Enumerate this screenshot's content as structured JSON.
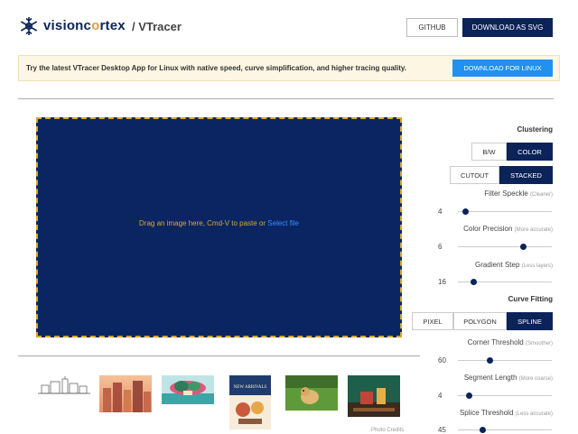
{
  "header": {
    "brand_a": "visionc",
    "brand_o": "o",
    "brand_b": "rtex",
    "title": "/ VTracer",
    "github_label": "GITHUB",
    "download_svg_label": "DOWNLOAD AS SVG"
  },
  "banner": {
    "text": "Try the latest VTracer Desktop App for Linux with native speed, curve simplification, and higher tracing quality.",
    "button_label": "DOWNLOAD FOR LINUX"
  },
  "canvas": {
    "drop_text": "Drag an image here, Cmd-V to paste or ",
    "select_link": "Select file"
  },
  "gallery": {
    "credits": "Photo Credits"
  },
  "clustering": {
    "title": "Clustering",
    "mode_options": [
      "B/W",
      "COLOR"
    ],
    "mode_selected": "COLOR",
    "layer_options": [
      "CUTOUT",
      "STACKED"
    ],
    "layer_selected": "STACKED",
    "params": [
      {
        "label": "Filter Speckle",
        "hint": "(Cleaner)",
        "value": "4",
        "fraction": 0.05
      },
      {
        "label": "Color Precision",
        "hint": "(More accurate)",
        "value": "6",
        "fraction": 0.71
      },
      {
        "label": "Gradient Step",
        "hint": "(Less layers)",
        "value": "16",
        "fraction": 0.14
      }
    ]
  },
  "curve_fitting": {
    "title": "Curve Fitting",
    "mode_options": [
      "PIXEL",
      "POLYGON",
      "SPLINE"
    ],
    "mode_selected": "SPLINE",
    "params": [
      {
        "label": "Corner Threshold",
        "hint": "(Smoother)",
        "value": "60",
        "fraction": 0.33
      },
      {
        "label": "Segment Length",
        "hint": "(More coarse)",
        "value": "4",
        "fraction": 0.09
      },
      {
        "label": "Splice Threshold",
        "hint": "(Less accurate)",
        "value": "45",
        "fraction": 0.25
      }
    ]
  },
  "colors": {
    "navy": "#0b2359",
    "canvas_bg": "#0a2561",
    "accent_gold": "#d4a52c",
    "banner_button": "#2190ee"
  }
}
